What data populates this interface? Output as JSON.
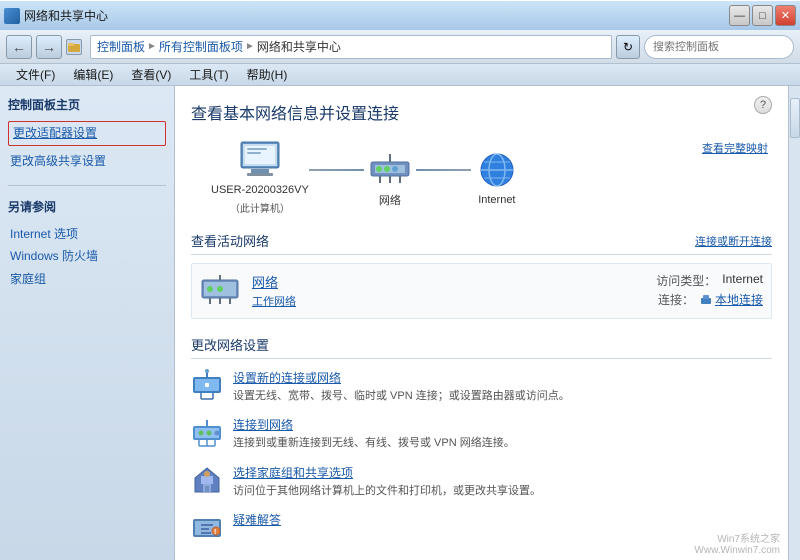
{
  "titleBar": {
    "title": "网络和共享中心",
    "controls": {
      "minimize": "—",
      "maximize": "□",
      "close": "✕"
    }
  },
  "addressBar": {
    "breadcrumbs": [
      {
        "label": "控制面板",
        "id": "cp"
      },
      {
        "label": "所有控制面板项",
        "id": "all"
      },
      {
        "label": "网络和共享中心",
        "id": "net"
      }
    ],
    "searchPlaceholder": "搜索控制面板"
  },
  "menuBar": {
    "items": [
      "文件(F)",
      "编辑(E)",
      "查看(V)",
      "工具(T)",
      "帮助(H)"
    ]
  },
  "sidebar": {
    "title": "控制面板主页",
    "links": [
      {
        "label": "更改适配器设置",
        "id": "adapter",
        "highlighted": true
      },
      {
        "label": "更改高级共享设置",
        "id": "advanced"
      }
    ],
    "otherSection": {
      "title": "另请参阅",
      "links": [
        {
          "label": "Internet 选项"
        },
        {
          "label": "Windows 防火墙"
        },
        {
          "label": "家庭组"
        }
      ]
    }
  },
  "content": {
    "pageTitle": "查看基本网络信息并设置连接",
    "viewFullMap": "查看完整映射",
    "networkDiagram": {
      "nodes": [
        {
          "label": "USER-20200326VY",
          "subLabel": "（此计算机）"
        },
        {
          "label": "网络"
        },
        {
          "label": "Internet"
        }
      ]
    },
    "activeNetworkSection": {
      "title": "查看活动网络",
      "actionLink": "连接或断开连接",
      "network": {
        "name": "网络",
        "type": "工作网络",
        "accessType": "Internet",
        "accessLabel": "访问类型：",
        "connectionLabel": "连接：",
        "connectionValue": "本地连接"
      }
    },
    "changeNetworkSection": {
      "title": "更改网络设置",
      "items": [
        {
          "id": "setup-new",
          "link": "设置新的连接或网络",
          "desc": "设置无线、宽带、拨号、临时或 VPN 连接；或设置路由器或访问点。"
        },
        {
          "id": "connect-to",
          "link": "连接到网络",
          "desc": "连接到或重新连接到无线、有线、拨号或 VPN 网络连接。"
        },
        {
          "id": "homegroup",
          "link": "选择家庭组和共享选项",
          "desc": "访问位于其他网络计算机上的文件和打印机，或更改共享设置。"
        },
        {
          "id": "troubleshoot",
          "link": "疑难解答",
          "desc": ""
        }
      ]
    }
  },
  "watermark": {
    "line1": "Win7系统之家",
    "line2": "Www.Winwin7.com"
  }
}
